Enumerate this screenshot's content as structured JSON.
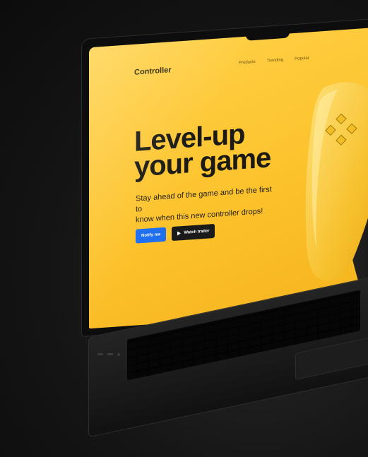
{
  "site": {
    "brand": "Controller",
    "nav": [
      "Products",
      "Trending",
      "Popular"
    ]
  },
  "hero": {
    "headline_line1": "Level-up",
    "headline_line2": "your game",
    "subtitle_line1": "Stay ahead of the game and be the first to",
    "subtitle_line2": "know when this new controller drops!",
    "primary_button": "Notify me",
    "secondary_button": "Watch trailer"
  },
  "colors": {
    "background": "#151515",
    "screen_yellow": "#fcc22b",
    "primary_blue": "#1f6ff2",
    "dark_button": "#1a1a1a",
    "text_dark": "#1c1a14"
  },
  "icons": [
    "play-icon",
    "dpad-icon"
  ]
}
